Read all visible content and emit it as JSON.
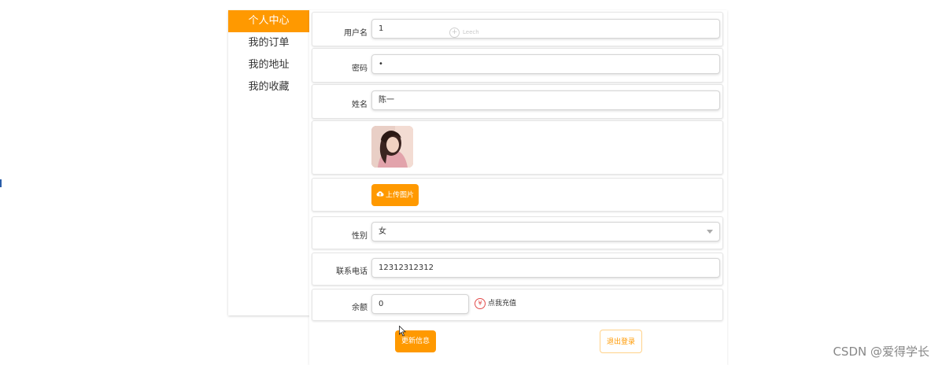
{
  "sidebar": {
    "items": [
      {
        "label": "个人中心",
        "active": true
      },
      {
        "label": "我的订单",
        "active": false
      },
      {
        "label": "我的地址",
        "active": false
      },
      {
        "label": "我的收藏",
        "active": false
      }
    ]
  },
  "form": {
    "username": {
      "label": "用户名",
      "value": "1",
      "ghost_text": "Leech"
    },
    "password": {
      "label": "密码",
      "value": "•"
    },
    "name": {
      "label": "姓名",
      "value": "陈一"
    },
    "upload": {
      "button_label": "上传图片",
      "icon": "cloud-upload-icon"
    },
    "gender": {
      "label": "性别",
      "selected": "女"
    },
    "phone": {
      "label": "联系电话",
      "value": "12312312312"
    },
    "balance": {
      "label": "余额",
      "value": "0",
      "recharge_label": "点我充值",
      "recharge_icon": "yen-icon"
    }
  },
  "actions": {
    "update_label": "更新信息",
    "logout_label": "退出登录"
  },
  "watermark": "CSDN @爱得学长",
  "colors": {
    "accent": "#ff9900",
    "recharge_icon": "#e24b4b"
  }
}
